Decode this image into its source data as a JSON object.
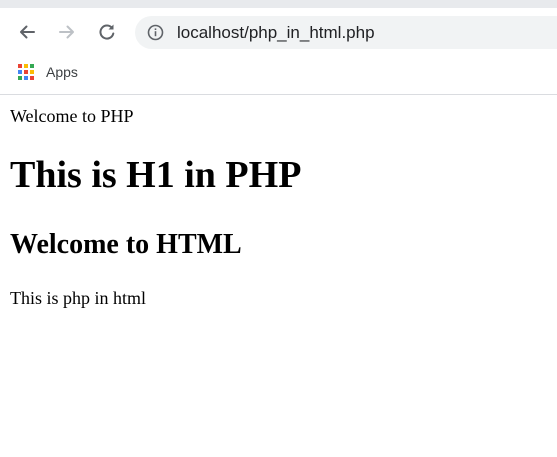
{
  "browser": {
    "url": "localhost/php_in_html.php",
    "bookmarks": [
      {
        "label": "Apps",
        "icon": "apps-grid-icon"
      }
    ],
    "icons": {
      "back": "arrow-left-icon",
      "forward": "arrow-right-icon",
      "reload": "reload-icon",
      "site_info": "info-icon"
    },
    "colors": {
      "toolbar_bg": "#ffffff",
      "omnibox_bg": "#f1f3f4",
      "icon_active": "#5f6368",
      "icon_disabled": "#bdc1c6"
    }
  },
  "page": {
    "welcome_php": "Welcome to PHP",
    "h1": "This is H1 in PHP",
    "h2": "Welcome to HTML",
    "paragraph": "This is php in html"
  }
}
